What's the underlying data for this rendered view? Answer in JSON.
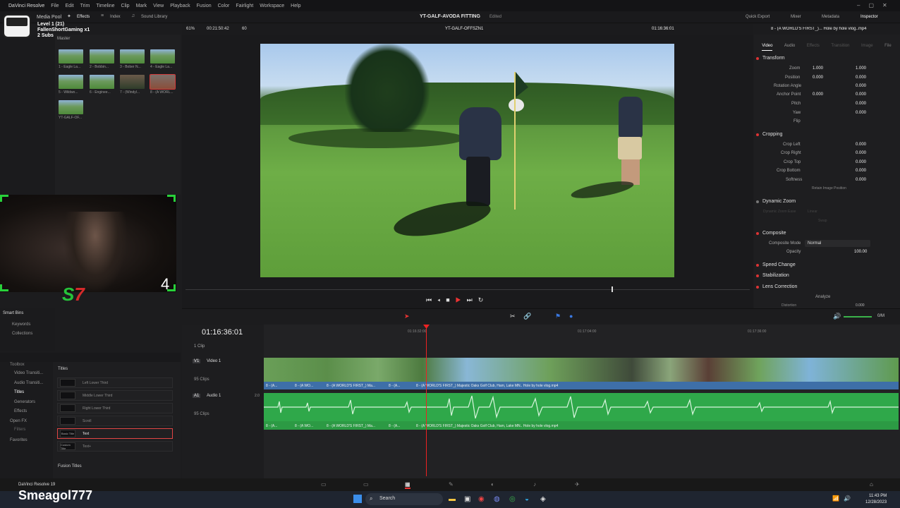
{
  "menu": {
    "app_name": "DaVinci Resolve",
    "items": [
      "File",
      "Edit",
      "Trim",
      "Timeline",
      "Clip",
      "Mark",
      "View",
      "Playback",
      "Fusion",
      "Color",
      "Fairlight",
      "Workspace",
      "Help"
    ]
  },
  "topbar": {
    "media_pool": "Media Pool",
    "effects": "Effects",
    "index": "Index",
    "sound_library": "Sound Library",
    "project_title": "YT-GALF-AVODA FITTING",
    "edited": "Edited",
    "quick_export": "Quick Export",
    "mixer": "Mixer",
    "metadata": "Metadata",
    "inspector": "Inspector"
  },
  "overlay": {
    "level": "Level 1  (21)",
    "user": "FallenShortGaming x1",
    "subs": "2 Subs",
    "cam_counter": "4",
    "streamer": "Smeagol777",
    "app_badge": "DaVinci Resolve 19"
  },
  "viewer": {
    "zoom": "61%",
    "source_tc": "00:21:50:42",
    "fps": "60",
    "timeline_name": "YT-GALF-OFFSZN1",
    "record_tc": "01:16:36:01",
    "clip_name": "8 - (A WORLD'S FIRST_)... Hole by hole vlog..mp4"
  },
  "media": {
    "bin": "Master",
    "thumbs": [
      {
        "label": "1 - Eagle La..."
      },
      {
        "label": "2 - Bobbin..."
      },
      {
        "label": "3 - Bober N..."
      },
      {
        "label": "4 - Eagle La..."
      },
      {
        "label": "5 - Wildwo..."
      },
      {
        "label": "6 - Enginee..."
      },
      {
        "label": "7 - (Windyl..."
      },
      {
        "label": "8 - (A WORL..."
      },
      {
        "label": "YT-GALF-OF..."
      }
    ],
    "smart_bins": "Smart Bins",
    "keywords": "Keywords",
    "collections": "Collections"
  },
  "effects": {
    "toolbox": "Toolbox",
    "video_transitions": "Video Transiti...",
    "audio_transitions": "Audio Transiti...",
    "titles": "Titles",
    "generators": "Generators",
    "effects": "Effects",
    "open_fx": "Open FX",
    "filters": "Filters",
    "favorites": "Favorites",
    "titles_header": "Titles",
    "fusion_titles": "Fusion Titles",
    "items": [
      {
        "mini": "",
        "label": "Left Lower Third"
      },
      {
        "mini": "",
        "label": "Middle Lower Third"
      },
      {
        "mini": "",
        "label": "Right Lower Third"
      },
      {
        "mini": "",
        "label": "Scroll"
      },
      {
        "mini": "Basic Title",
        "label": "Text"
      },
      {
        "mini": "Custom Title",
        "label": "Text+"
      }
    ]
  },
  "inspector": {
    "tabs": [
      "Video",
      "Audio",
      "Effects",
      "Transition",
      "Image",
      "File"
    ],
    "transform": "Transform",
    "zoom_label": "Zoom",
    "zoom_x": "1.000",
    "zoom_y": "1.000",
    "position_label": "Position",
    "pos_x": "0.000",
    "pos_y": "0.000",
    "rotation_label": "Rotation Angle",
    "rotation": "0.000",
    "anchor_label": "Anchor Point",
    "anchor_x": "0.000",
    "anchor_y": "0.000",
    "pitch_label": "Pitch",
    "pitch": "0.000",
    "yaw_label": "Yaw",
    "yaw": "0.000",
    "flip_label": "Flip",
    "cropping": "Cropping",
    "crop_left_label": "Crop Left",
    "crop_left": "0.000",
    "crop_right_label": "Crop Right",
    "crop_right": "0.000",
    "crop_top_label": "Crop Top",
    "crop_top": "0.000",
    "crop_bottom_label": "Crop Bottom",
    "crop_bottom": "0.000",
    "softness_label": "Softness",
    "softness": "0.000",
    "retain_label": "Retain Image Position",
    "dynamic_zoom": "Dynamic Zoom",
    "dz_ease_label": "Dynamic Zoom Ease",
    "dz_ease": "Linear",
    "dz_swap": "Swap",
    "composite": "Composite",
    "composite_mode_label": "Composite Mode",
    "composite_mode": "Normal",
    "opacity_label": "Opacity",
    "opacity": "100.00",
    "speed_change": "Speed Change",
    "stabilization": "Stabilization",
    "lens_correction": "Lens Correction",
    "analyze": "Analyze",
    "distortion_label": "Distortion",
    "distortion": "0.000"
  },
  "timeline": {
    "timecode": "01:16:36:01",
    "clip_count": "1 Clip",
    "v1": "V1",
    "video1": "Video 1",
    "v_clips": "95 Clips",
    "a1": "A1",
    "audio1": "Audio 1",
    "a_level": "2.0",
    "a_clips": "95 Clips",
    "ruler": [
      "01:16:32:00",
      "01:17:04:00",
      "01:17:36:00"
    ],
    "clip_main": "8 - (A WORLD'S FIRST_) Majestic Oaks Golf Club, Ham, Lake MN.. Hole by hole vlog.mp4",
    "clip_short": [
      "8 - (A...",
      "8 - (A WO...",
      "8 - (A WORLD'S FIRST_) Ma...",
      "8 - (A...",
      "8 - (A..."
    ],
    "audio_meter": "0/M"
  },
  "taskbar": {
    "search": "Search",
    "time": "11:43 PM",
    "date": "12/28/2023"
  }
}
